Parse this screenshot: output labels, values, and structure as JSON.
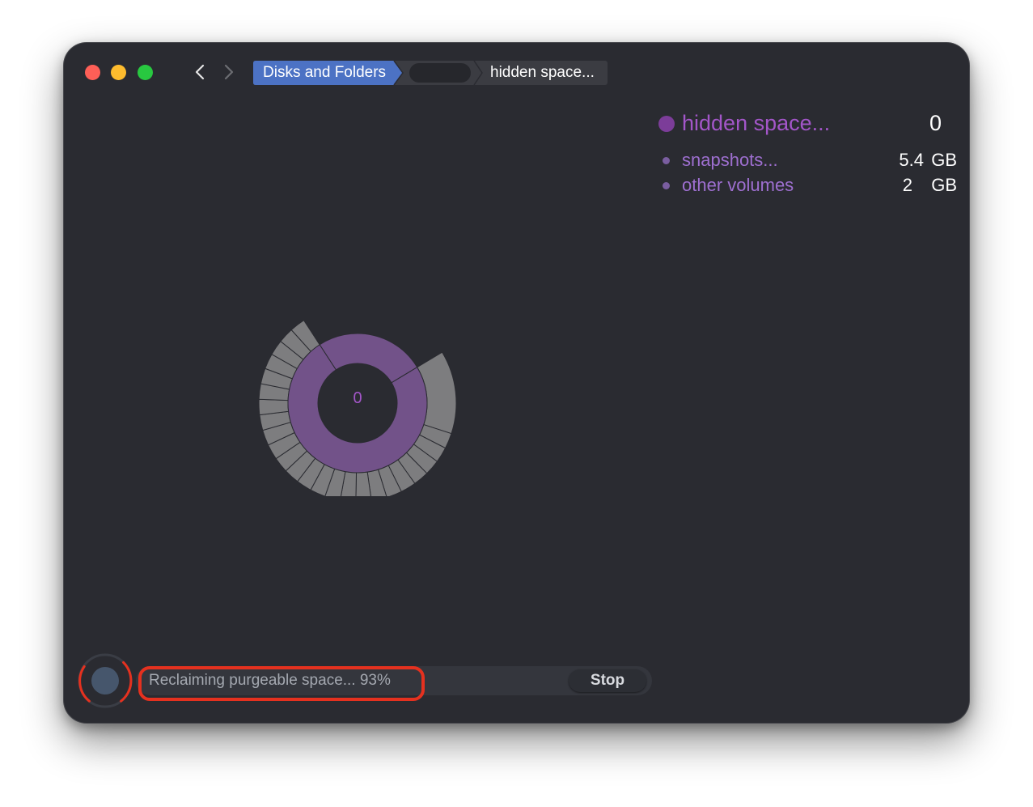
{
  "toolbar": {
    "back_icon": "chevron-left-icon",
    "forward_icon": "chevron-right-icon"
  },
  "breadcrumb": {
    "items": [
      {
        "label": "Disks and Folders",
        "active": true
      },
      {
        "label": "",
        "redacted": true
      },
      {
        "label": "hidden space..."
      }
    ]
  },
  "legend": {
    "main": {
      "label": "hidden space...",
      "value": "0",
      "color": "#7c3d99"
    },
    "items": [
      {
        "label": "snapshots...",
        "value": "5.4",
        "unit": "GB"
      },
      {
        "label": "other volumes",
        "value": "2",
        "unit": "GB"
      }
    ]
  },
  "chart": {
    "center_label": "0",
    "inner_color": "#725289",
    "outer_color": "#7d7d7f"
  },
  "status": {
    "text": "Reclaiming purgeable space... 93%",
    "progress_percent": 93,
    "stop_label": "Stop",
    "highlight_color": "#e5311f"
  }
}
